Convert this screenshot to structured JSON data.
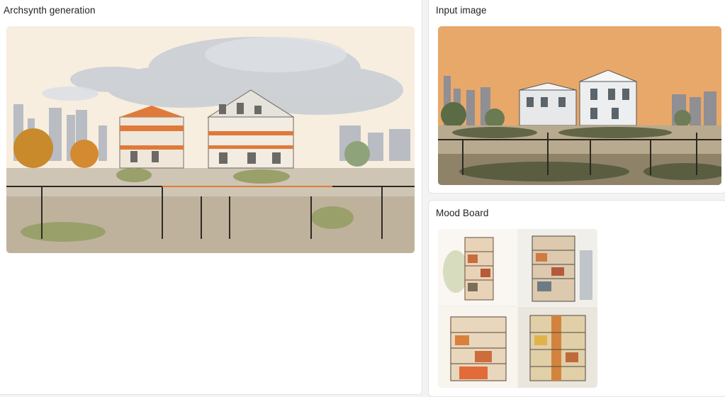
{
  "panels": {
    "generation": {
      "title": "Archsynth generation"
    },
    "input": {
      "title": "Input image"
    },
    "mood": {
      "title": "Mood Board"
    }
  },
  "colors": {
    "input_sky": "#e8a86a",
    "gen_sky": "#f7eee0",
    "accent_orange": "#e07a3a"
  },
  "icons": {
    "generated": "architecture-render-image",
    "input": "site-photo-image",
    "mood": "sketch-collage-image"
  }
}
